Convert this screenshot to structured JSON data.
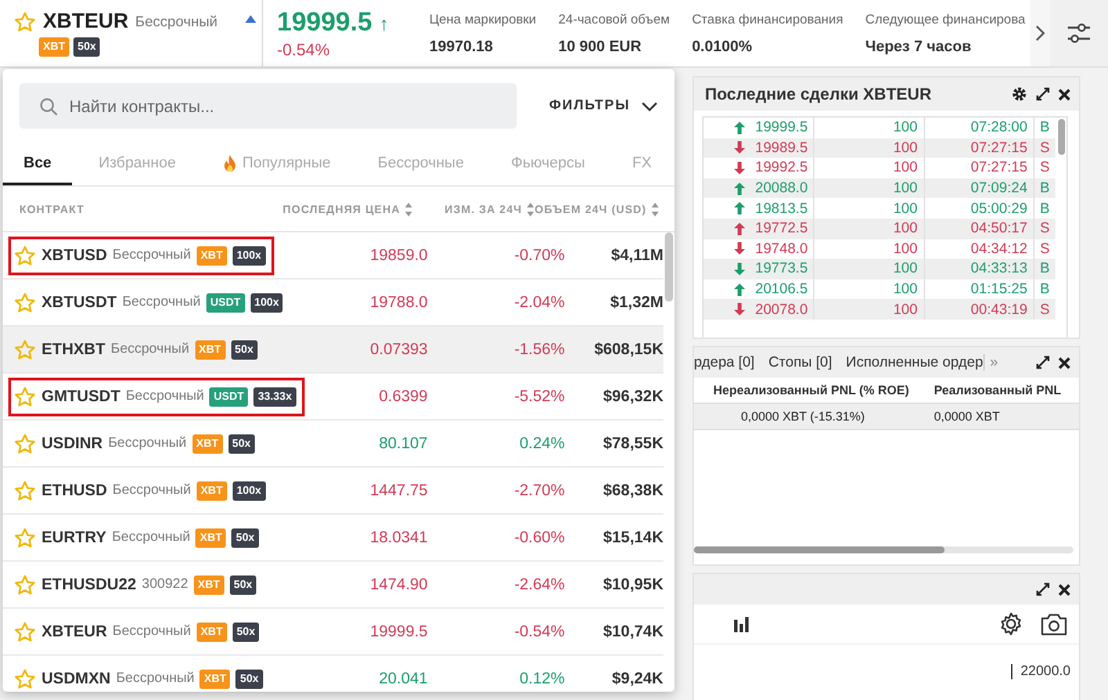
{
  "header": {
    "symbol": "XBTEUR",
    "type": "Бессрочный",
    "collateral": {
      "label": "XBT",
      "kind": "xbt"
    },
    "leverage": "50x",
    "price": {
      "value": "19999.5",
      "color": "#1c9e6b"
    },
    "price_arrow": "↑",
    "change": {
      "value": "-0.54%",
      "color": "#d13a55"
    },
    "stats": [
      {
        "label": "Цена маркировки",
        "value": "19970.18"
      },
      {
        "label": "24-часовой объем",
        "value": "10 900 EUR"
      },
      {
        "label": "Ставка финансирования",
        "value": "0.0100%"
      },
      {
        "label": "Следующее финансирова",
        "value": "Через 7 часов"
      }
    ]
  },
  "picker": {
    "search": {
      "placeholder": "Найти контракты..."
    },
    "filters": "ФИЛЬТРЫ",
    "tabs": [
      {
        "label": "Все",
        "selected": true,
        "kind": "plain"
      },
      {
        "label": "Избранное",
        "selected": false,
        "kind": "plain"
      },
      {
        "label": "Популярные",
        "selected": false,
        "kind": "fire"
      },
      {
        "label": "Бессрочные",
        "selected": false,
        "kind": "plain"
      },
      {
        "label": "Фьючерсы",
        "selected": false,
        "kind": "plain"
      },
      {
        "label": "FX",
        "selected": false,
        "kind": "plain"
      }
    ],
    "columns": [
      {
        "label": "КОНТРАКТ",
        "sortable": false
      },
      {
        "label": "ПОСЛЕДНЯЯ ЦЕНА",
        "sortable": true
      },
      {
        "label": "ИЗМ. ЗА 24Ч",
        "sortable": true
      },
      {
        "label": "ОБЪЕМ 24Ч (USD)",
        "sortable": true
      }
    ],
    "rows": [
      {
        "symbol": "XBTUSD",
        "type": "Бессрочный",
        "collateral": {
          "label": "XBT",
          "kind": "xbt"
        },
        "leverage": "100x",
        "price": "19859.0",
        "change": "-0.70%",
        "color": "#d13a55",
        "volume": "$4,11M",
        "outlined": true,
        "hovered": false
      },
      {
        "symbol": "XBTUSDT",
        "type": "Бессрочный",
        "collateral": {
          "label": "USDT",
          "kind": "usdt"
        },
        "leverage": "100x",
        "price": "19788.0",
        "change": "-2.04%",
        "color": "#d13a55",
        "volume": "$1,32M",
        "outlined": false,
        "hovered": false
      },
      {
        "symbol": "ETHXBT",
        "type": "Бессрочный",
        "collateral": {
          "label": "XBT",
          "kind": "xbt"
        },
        "leverage": "50x",
        "price": "0.07393",
        "change": "-1.56%",
        "color": "#d13a55",
        "volume": "$608,15K",
        "outlined": false,
        "hovered": true
      },
      {
        "symbol": "GMTUSDT",
        "type": "Бессрочный",
        "collateral": {
          "label": "USDT",
          "kind": "usdt"
        },
        "leverage": "33.33x",
        "price": "0.6399",
        "change": "-5.52%",
        "color": "#d13a55",
        "volume": "$96,32K",
        "outlined": true,
        "hovered": false
      },
      {
        "symbol": "USDINR",
        "type": "Бессрочный",
        "collateral": {
          "label": "XBT",
          "kind": "xbt"
        },
        "leverage": "50x",
        "price": "80.107",
        "change": "0.24%",
        "color": "#1c9e6b",
        "volume": "$78,55K",
        "outlined": false,
        "hovered": false
      },
      {
        "symbol": "ETHUSD",
        "type": "Бессрочный",
        "collateral": {
          "label": "XBT",
          "kind": "xbt"
        },
        "leverage": "100x",
        "price": "1447.75",
        "change": "-2.70%",
        "color": "#d13a55",
        "volume": "$68,38K",
        "outlined": false,
        "hovered": false
      },
      {
        "symbol": "EURTRY",
        "type": "Бессрочный",
        "collateral": {
          "label": "XBT",
          "kind": "xbt"
        },
        "leverage": "50x",
        "price": "18.0341",
        "change": "-0.60%",
        "color": "#d13a55",
        "volume": "$15,14K",
        "outlined": false,
        "hovered": false
      },
      {
        "symbol": "ETHUSDU22",
        "type": "300922",
        "collateral": {
          "label": "XBT",
          "kind": "xbt"
        },
        "leverage": "50x",
        "price": "1474.90",
        "change": "-2.64%",
        "color": "#d13a55",
        "volume": "$10,95K",
        "outlined": false,
        "hovered": false
      },
      {
        "symbol": "XBTEUR",
        "type": "Бессрочный",
        "collateral": {
          "label": "XBT",
          "kind": "xbt"
        },
        "leverage": "50x",
        "price": "19999.5",
        "change": "-0.54%",
        "color": "#d13a55",
        "volume": "$10,74K",
        "outlined": false,
        "hovered": false
      },
      {
        "symbol": "USDMXN",
        "type": "Бессрочный",
        "collateral": {
          "label": "XBT",
          "kind": "xbt"
        },
        "leverage": "50x",
        "price": "20.041",
        "change": "0.12%",
        "color": "#1c9e6b",
        "volume": "$9,24K",
        "outlined": false,
        "hovered": false
      }
    ]
  },
  "trades": {
    "title": "Последние сделки XBTEUR",
    "rows": [
      {
        "price": "19999.5",
        "kind": "up",
        "size": "100",
        "time": "07:28:00",
        "side": "B"
      },
      {
        "price": "19989.5",
        "kind": "down",
        "size": "100",
        "time": "07:27:15",
        "side": "S"
      },
      {
        "price": "19992.5",
        "kind": "down",
        "size": "100",
        "time": "07:27:15",
        "side": "S"
      },
      {
        "price": "20088.0",
        "kind": "up",
        "size": "100",
        "time": "07:09:24",
        "side": "B"
      },
      {
        "price": "19813.5",
        "kind": "up",
        "size": "100",
        "time": "05:00:29",
        "side": "B"
      },
      {
        "price": "19772.5",
        "kind": "up",
        "size": "100",
        "time": "04:50:17",
        "side": "S"
      },
      {
        "price": "19748.0",
        "kind": "down",
        "size": "100",
        "time": "04:34:12",
        "side": "S"
      },
      {
        "price": "19773.5",
        "kind": "down",
        "size": "100",
        "time": "04:33:13",
        "side": "B"
      },
      {
        "price": "20106.5",
        "kind": "up",
        "size": "100",
        "time": "01:15:25",
        "side": "B"
      },
      {
        "price": "20078.0",
        "kind": "down",
        "size": "100",
        "time": "00:43:19",
        "side": "S"
      }
    ]
  },
  "orders": {
    "tabs": [
      {
        "label": "рдера [0]",
        "selected": false
      },
      {
        "label": "Стопы [0]",
        "selected": false
      },
      {
        "label": "Исполненные ордер",
        "selected": false
      }
    ],
    "more": "»",
    "columns": [
      "Нереализованный PNL (% ROE)",
      "Реализованный PNL"
    ],
    "row": [
      "0,0000 XBT (-15.31%)",
      "0,0000 XBT"
    ]
  },
  "chart": {
    "axis_label": "22000.0"
  }
}
